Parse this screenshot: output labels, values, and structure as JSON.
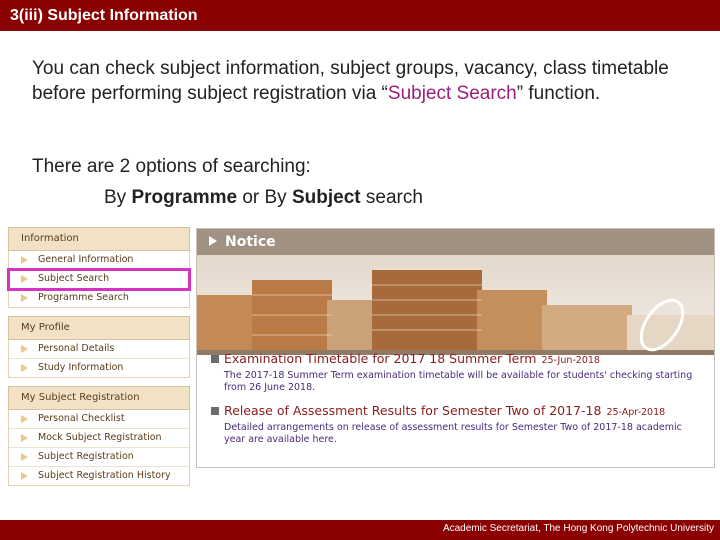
{
  "slide": {
    "title": "3(iii) Subject Information",
    "intro_before": "You can check subject information, subject groups, vacancy, class timetable before performing subject registration via “",
    "intro_highlight": "Subject Search",
    "intro_after": "” function.",
    "options_line": "There are 2 options of searching:",
    "options_prefix": "By ",
    "options_programme": "Programme",
    "options_mid": " or By ",
    "options_subject": "Subject",
    "options_suffix": " search",
    "footer": "Academic Secretariat, The Hong Kong Polytechnic University"
  },
  "sidebar": {
    "sections": [
      {
        "heading": "Information",
        "items": [
          "General Information",
          "Subject Search",
          "Programme Search"
        ]
      },
      {
        "heading": "My Profile",
        "items": [
          "Personal Details",
          "Study Information"
        ]
      },
      {
        "heading": "My Subject Registration",
        "items": [
          "Personal Checklist",
          "Mock Subject Registration",
          "Subject Registration",
          "Subject Registration History"
        ]
      }
    ]
  },
  "notice": {
    "heading": "Notice",
    "items": [
      {
        "title": "Examination Timetable for 2017 18 Summer Term",
        "date": "25-Jun-2018",
        "body": "The 2017-18 Summer Term examination timetable will be available for students' checking starting from 26 June 2018."
      },
      {
        "title": "Release of Assessment Results for Semester Two of 2017-18",
        "date": "25-Apr-2018",
        "body": "Detailed arrangements on release of assessment results for Semester Two of 2017-18 academic year are available here."
      }
    ]
  },
  "colors": {
    "brand": "#8b0000",
    "highlight": "#9b1f7a",
    "selection": "#d633c2"
  }
}
